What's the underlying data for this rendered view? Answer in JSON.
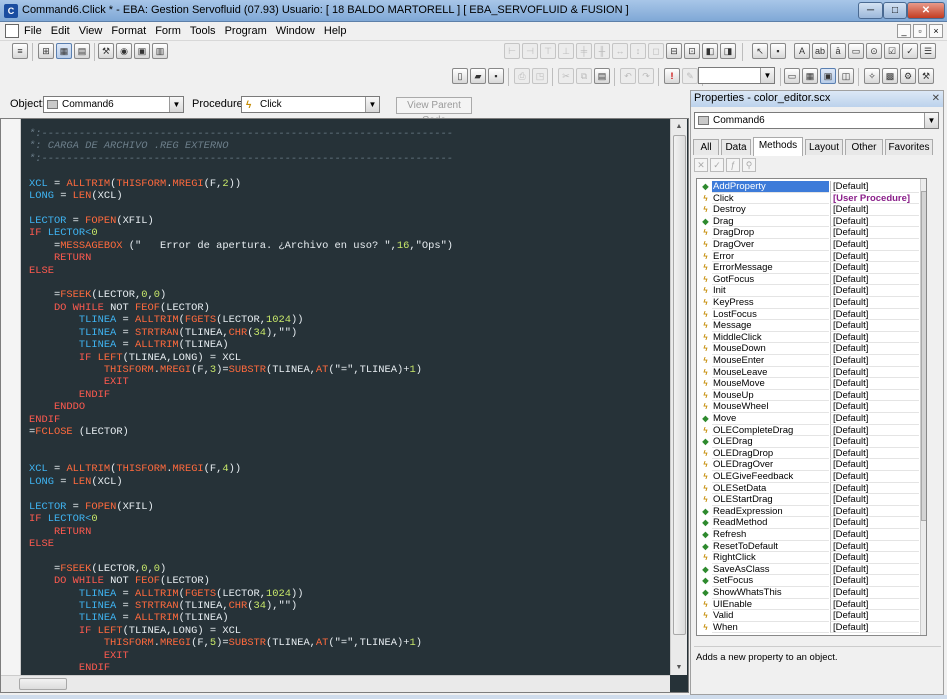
{
  "window": {
    "title": "Command6.Click * - EBA: Gestion Servofluid   (07.93)     Usuario: [ 18  BALDO MARTORELL ]     [ EBA_SERVOFLUID & FUSION ]",
    "app_icon": "vfp-icon"
  },
  "menu": [
    "File",
    "Edit",
    "View",
    "Format",
    "Form",
    "Tools",
    "Program",
    "Window",
    "Help"
  ],
  "object_bar": {
    "object_label": "Object:",
    "object_value": "Command6",
    "procedure_label": "Procedure:",
    "procedure_value": "Click",
    "view_parent_label": "View Parent Code"
  },
  "code_lines": [
    [
      {
        "t": "*:------------------------------------------------------------------",
        "c": "c"
      }
    ],
    [
      {
        "t": "*: CARGA DE ARCHIVO .REG EXTERNO",
        "c": "c"
      }
    ],
    [
      {
        "t": "*:------------------------------------------------------------------",
        "c": "c"
      }
    ],
    [],
    [
      {
        "t": "XCL",
        "c": "v"
      },
      {
        "t": " = ",
        "c": "o"
      },
      {
        "t": "ALLTRIM",
        "c": "f"
      },
      {
        "t": "(",
        "c": "o"
      },
      {
        "t": "THISFORM",
        "c": "f"
      },
      {
        "t": ".",
        "c": "o"
      },
      {
        "t": "MREGI",
        "c": "f"
      },
      {
        "t": "(F,",
        "c": "o"
      },
      {
        "t": "2",
        "c": "n"
      },
      {
        "t": "))",
        "c": "o"
      }
    ],
    [
      {
        "t": "LONG",
        "c": "v"
      },
      {
        "t": " = ",
        "c": "o"
      },
      {
        "t": "LEN",
        "c": "f"
      },
      {
        "t": "(XCL)",
        "c": "o"
      }
    ],
    [],
    [
      {
        "t": "LECTOR",
        "c": "v"
      },
      {
        "t": " = ",
        "c": "o"
      },
      {
        "t": "FOPEN",
        "c": "f"
      },
      {
        "t": "(XFIL)",
        "c": "o"
      }
    ],
    [
      {
        "t": "IF",
        "c": "k"
      },
      {
        "t": " LECTOR<",
        "c": "v"
      },
      {
        "t": "0",
        "c": "n"
      }
    ],
    [
      {
        "t": "    =",
        "c": "o"
      },
      {
        "t": "MESSAGEBOX",
        "c": "f"
      },
      {
        "t": " (\"   Error de apertura. ¿Archivo en uso? \",",
        "c": "s"
      },
      {
        "t": "16",
        "c": "n"
      },
      {
        "t": ",\"Ops\")",
        "c": "s"
      }
    ],
    [
      {
        "t": "    RETURN",
        "c": "k"
      }
    ],
    [
      {
        "t": "ELSE",
        "c": "k"
      }
    ],
    [],
    [
      {
        "t": "    =",
        "c": "o"
      },
      {
        "t": "FSEEK",
        "c": "f"
      },
      {
        "t": "(LECTOR,",
        "c": "o"
      },
      {
        "t": "0",
        "c": "n"
      },
      {
        "t": ",",
        "c": "o"
      },
      {
        "t": "0",
        "c": "n"
      },
      {
        "t": ")",
        "c": "o"
      }
    ],
    [
      {
        "t": "    DO WHILE",
        "c": "k"
      },
      {
        "t": " NOT ",
        "c": "o"
      },
      {
        "t": "FEOF",
        "c": "f"
      },
      {
        "t": "(LECTOR)",
        "c": "o"
      }
    ],
    [
      {
        "t": "        TLINEA",
        "c": "v"
      },
      {
        "t": " = ",
        "c": "o"
      },
      {
        "t": "ALLTRIM",
        "c": "f"
      },
      {
        "t": "(",
        "c": "o"
      },
      {
        "t": "FGETS",
        "c": "f"
      },
      {
        "t": "(LECTOR,",
        "c": "o"
      },
      {
        "t": "1024",
        "c": "n"
      },
      {
        "t": "))",
        "c": "o"
      }
    ],
    [
      {
        "t": "        TLINEA",
        "c": "v"
      },
      {
        "t": " = ",
        "c": "o"
      },
      {
        "t": "STRTRAN",
        "c": "f"
      },
      {
        "t": "(TLINEA,",
        "c": "o"
      },
      {
        "t": "CHR",
        "c": "f"
      },
      {
        "t": "(",
        "c": "o"
      },
      {
        "t": "34",
        "c": "n"
      },
      {
        "t": "),\"\")",
        "c": "o"
      }
    ],
    [
      {
        "t": "        TLINEA",
        "c": "v"
      },
      {
        "t": " = ",
        "c": "o"
      },
      {
        "t": "ALLTRIM",
        "c": "f"
      },
      {
        "t": "(TLINEA)",
        "c": "o"
      }
    ],
    [
      {
        "t": "        IF",
        "c": "k"
      },
      {
        "t": " ",
        "c": "o"
      },
      {
        "t": "LEFT",
        "c": "f"
      },
      {
        "t": "(TLINEA,LONG) = XCL",
        "c": "o"
      }
    ],
    [
      {
        "t": "            THISFORM",
        "c": "f"
      },
      {
        "t": ".",
        "c": "o"
      },
      {
        "t": "MREGI",
        "c": "f"
      },
      {
        "t": "(F,",
        "c": "o"
      },
      {
        "t": "3",
        "c": "n"
      },
      {
        "t": ")=",
        "c": "o"
      },
      {
        "t": "SUBSTR",
        "c": "f"
      },
      {
        "t": "(TLINEA,",
        "c": "o"
      },
      {
        "t": "AT",
        "c": "f"
      },
      {
        "t": "(\"=\",TLINEA)+",
        "c": "o"
      },
      {
        "t": "1",
        "c": "n"
      },
      {
        "t": ")",
        "c": "o"
      }
    ],
    [
      {
        "t": "            EXIT",
        "c": "k"
      }
    ],
    [
      {
        "t": "        ENDIF",
        "c": "k"
      }
    ],
    [
      {
        "t": "    ENDDO",
        "c": "k"
      }
    ],
    [
      {
        "t": "ENDIF",
        "c": "k"
      }
    ],
    [
      {
        "t": "=",
        "c": "o"
      },
      {
        "t": "FCLOSE",
        "c": "f"
      },
      {
        "t": " (LECTOR)",
        "c": "o"
      }
    ],
    [],
    [],
    [
      {
        "t": "XCL",
        "c": "v"
      },
      {
        "t": " = ",
        "c": "o"
      },
      {
        "t": "ALLTRIM",
        "c": "f"
      },
      {
        "t": "(",
        "c": "o"
      },
      {
        "t": "THISFORM",
        "c": "f"
      },
      {
        "t": ".",
        "c": "o"
      },
      {
        "t": "MREGI",
        "c": "f"
      },
      {
        "t": "(F,",
        "c": "o"
      },
      {
        "t": "4",
        "c": "n"
      },
      {
        "t": "))",
        "c": "o"
      }
    ],
    [
      {
        "t": "LONG",
        "c": "v"
      },
      {
        "t": " = ",
        "c": "o"
      },
      {
        "t": "LEN",
        "c": "f"
      },
      {
        "t": "(XCL)",
        "c": "o"
      }
    ],
    [],
    [
      {
        "t": "LECTOR",
        "c": "v"
      },
      {
        "t": " = ",
        "c": "o"
      },
      {
        "t": "FOPEN",
        "c": "f"
      },
      {
        "t": "(XFIL)",
        "c": "o"
      }
    ],
    [
      {
        "t": "IF",
        "c": "k"
      },
      {
        "t": " LECTOR<",
        "c": "v"
      },
      {
        "t": "0",
        "c": "n"
      }
    ],
    [
      {
        "t": "    RETURN",
        "c": "k"
      }
    ],
    [
      {
        "t": "ELSE",
        "c": "k"
      }
    ],
    [],
    [
      {
        "t": "    =",
        "c": "o"
      },
      {
        "t": "FSEEK",
        "c": "f"
      },
      {
        "t": "(LECTOR,",
        "c": "o"
      },
      {
        "t": "0",
        "c": "n"
      },
      {
        "t": ",",
        "c": "o"
      },
      {
        "t": "0",
        "c": "n"
      },
      {
        "t": ")",
        "c": "o"
      }
    ],
    [
      {
        "t": "    DO WHILE",
        "c": "k"
      },
      {
        "t": " NOT ",
        "c": "o"
      },
      {
        "t": "FEOF",
        "c": "f"
      },
      {
        "t": "(LECTOR)",
        "c": "o"
      }
    ],
    [
      {
        "t": "        TLINEA",
        "c": "v"
      },
      {
        "t": " = ",
        "c": "o"
      },
      {
        "t": "ALLTRIM",
        "c": "f"
      },
      {
        "t": "(",
        "c": "o"
      },
      {
        "t": "FGETS",
        "c": "f"
      },
      {
        "t": "(LECTOR,",
        "c": "o"
      },
      {
        "t": "1024",
        "c": "n"
      },
      {
        "t": "))",
        "c": "o"
      }
    ],
    [
      {
        "t": "        TLINEA",
        "c": "v"
      },
      {
        "t": " = ",
        "c": "o"
      },
      {
        "t": "STRTRAN",
        "c": "f"
      },
      {
        "t": "(TLINEA,",
        "c": "o"
      },
      {
        "t": "CHR",
        "c": "f"
      },
      {
        "t": "(",
        "c": "o"
      },
      {
        "t": "34",
        "c": "n"
      },
      {
        "t": "),\"\")",
        "c": "o"
      }
    ],
    [
      {
        "t": "        TLINEA",
        "c": "v"
      },
      {
        "t": " = ",
        "c": "o"
      },
      {
        "t": "ALLTRIM",
        "c": "f"
      },
      {
        "t": "(TLINEA)",
        "c": "o"
      }
    ],
    [
      {
        "t": "        IF",
        "c": "k"
      },
      {
        "t": " ",
        "c": "o"
      },
      {
        "t": "LEFT",
        "c": "f"
      },
      {
        "t": "(TLINEA,LONG) = XCL",
        "c": "o"
      }
    ],
    [
      {
        "t": "            THISFORM",
        "c": "f"
      },
      {
        "t": ".",
        "c": "o"
      },
      {
        "t": "MREGI",
        "c": "f"
      },
      {
        "t": "(F,",
        "c": "o"
      },
      {
        "t": "5",
        "c": "n"
      },
      {
        "t": ")=",
        "c": "o"
      },
      {
        "t": "SUBSTR",
        "c": "f"
      },
      {
        "t": "(TLINEA,",
        "c": "o"
      },
      {
        "t": "AT",
        "c": "f"
      },
      {
        "t": "(\"=\",TLINEA)+",
        "c": "o"
      },
      {
        "t": "1",
        "c": "n"
      },
      {
        "t": ")",
        "c": "o"
      }
    ],
    [
      {
        "t": "            EXIT",
        "c": "k"
      }
    ],
    [
      {
        "t": "        ENDIF",
        "c": "k"
      }
    ]
  ],
  "code_colors": {
    "background": "#263238",
    "comment": "#6c7e8a",
    "function": "#ff6a3d",
    "keyword": "#ff5a4f",
    "variable": "#3fb4f2",
    "number": "#c8e86a"
  },
  "properties": {
    "title": "Properties - color_editor.scx",
    "object": "Command6",
    "tabs": [
      "All",
      "Data",
      "Methods",
      "Layout",
      "Other",
      "Favorites"
    ],
    "selected_tab": "Methods",
    "items": [
      {
        "name": "AddProperty",
        "value": "[Default]",
        "icon": "method"
      },
      {
        "name": "Click",
        "value": "[User Procedure]",
        "icon": "event"
      },
      {
        "name": "Destroy",
        "value": "[Default]",
        "icon": "event"
      },
      {
        "name": "Drag",
        "value": "[Default]",
        "icon": "method"
      },
      {
        "name": "DragDrop",
        "value": "[Default]",
        "icon": "event"
      },
      {
        "name": "DragOver",
        "value": "[Default]",
        "icon": "event"
      },
      {
        "name": "Error",
        "value": "[Default]",
        "icon": "event"
      },
      {
        "name": "ErrorMessage",
        "value": "[Default]",
        "icon": "event"
      },
      {
        "name": "GotFocus",
        "value": "[Default]",
        "icon": "event"
      },
      {
        "name": "Init",
        "value": "[Default]",
        "icon": "event"
      },
      {
        "name": "KeyPress",
        "value": "[Default]",
        "icon": "event"
      },
      {
        "name": "LostFocus",
        "value": "[Default]",
        "icon": "event"
      },
      {
        "name": "Message",
        "value": "[Default]",
        "icon": "event"
      },
      {
        "name": "MiddleClick",
        "value": "[Default]",
        "icon": "event"
      },
      {
        "name": "MouseDown",
        "value": "[Default]",
        "icon": "event"
      },
      {
        "name": "MouseEnter",
        "value": "[Default]",
        "icon": "event"
      },
      {
        "name": "MouseLeave",
        "value": "[Default]",
        "icon": "event"
      },
      {
        "name": "MouseMove",
        "value": "[Default]",
        "icon": "event"
      },
      {
        "name": "MouseUp",
        "value": "[Default]",
        "icon": "event"
      },
      {
        "name": "MouseWheel",
        "value": "[Default]",
        "icon": "event"
      },
      {
        "name": "Move",
        "value": "[Default]",
        "icon": "method"
      },
      {
        "name": "OLECompleteDrag",
        "value": "[Default]",
        "icon": "event"
      },
      {
        "name": "OLEDrag",
        "value": "[Default]",
        "icon": "method"
      },
      {
        "name": "OLEDragDrop",
        "value": "[Default]",
        "icon": "event"
      },
      {
        "name": "OLEDragOver",
        "value": "[Default]",
        "icon": "event"
      },
      {
        "name": "OLEGiveFeedback",
        "value": "[Default]",
        "icon": "event"
      },
      {
        "name": "OLESetData",
        "value": "[Default]",
        "icon": "event"
      },
      {
        "name": "OLEStartDrag",
        "value": "[Default]",
        "icon": "event"
      },
      {
        "name": "ReadExpression",
        "value": "[Default]",
        "icon": "method"
      },
      {
        "name": "ReadMethod",
        "value": "[Default]",
        "icon": "method"
      },
      {
        "name": "Refresh",
        "value": "[Default]",
        "icon": "method"
      },
      {
        "name": "ResetToDefault",
        "value": "[Default]",
        "icon": "method"
      },
      {
        "name": "RightClick",
        "value": "[Default]",
        "icon": "event"
      },
      {
        "name": "SaveAsClass",
        "value": "[Default]",
        "icon": "method"
      },
      {
        "name": "SetFocus",
        "value": "[Default]",
        "icon": "method"
      },
      {
        "name": "ShowWhatsThis",
        "value": "[Default]",
        "icon": "method"
      },
      {
        "name": "UIEnable",
        "value": "[Default]",
        "icon": "event"
      },
      {
        "name": "Valid",
        "value": "[Default]",
        "icon": "event"
      },
      {
        "name": "When",
        "value": "[Default]",
        "icon": "event"
      }
    ],
    "selected_item": "AddProperty",
    "description": "Adds a new property to an object."
  }
}
